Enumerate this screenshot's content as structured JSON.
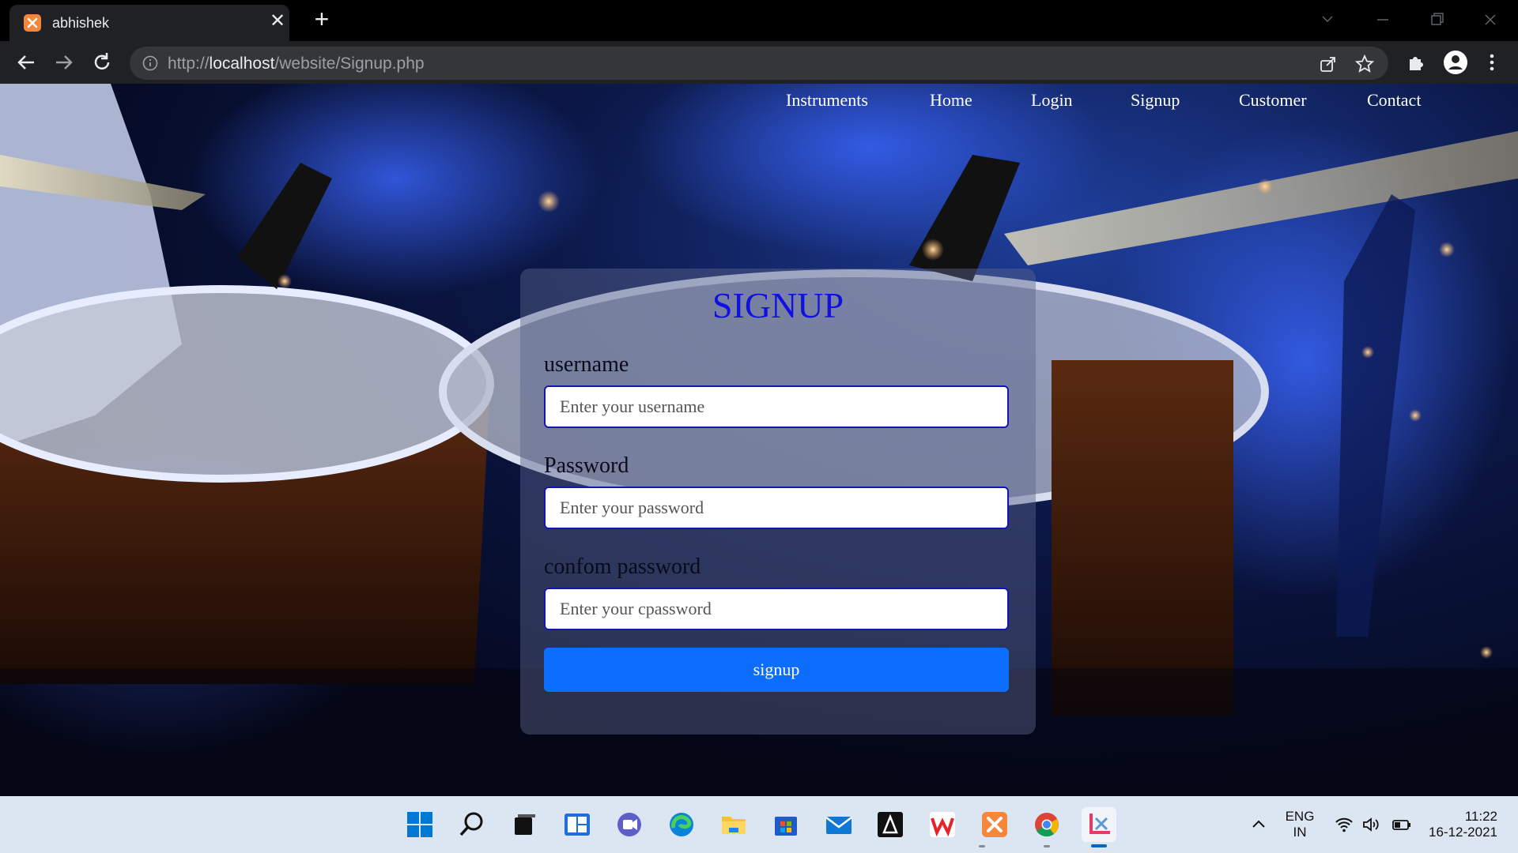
{
  "browser": {
    "tab_title": "abhishek",
    "tab_close": "✕",
    "new_tab": "+",
    "url_prefix": "http://",
    "url_host": "localhost",
    "url_path": "/website/Signup.php"
  },
  "site_nav": {
    "items": [
      "Instruments",
      "Home",
      "Login",
      "Signup",
      "Customer",
      "Contact"
    ]
  },
  "form": {
    "title": "SIGNUP",
    "username_label": "username",
    "username_placeholder": "Enter your username",
    "password_label": "Password",
    "password_placeholder": "Enter your password",
    "cpassword_label": "confom password",
    "cpassword_placeholder": "Enter your cpassword",
    "submit_label": "signup"
  },
  "taskbar": {
    "apps": [
      "start",
      "search",
      "task-view",
      "widgets",
      "chat",
      "edge",
      "file-explorer",
      "store",
      "mail",
      "app",
      "wps",
      "xampp",
      "chrome",
      "snipping-tool"
    ],
    "lang_top": "ENG",
    "lang_bottom": "IN",
    "time": "11:22",
    "date": "16-12-2021"
  },
  "colors": {
    "title_blue": "#1010e0",
    "button_blue": "#0d6efd",
    "input_border": "#1414b8"
  }
}
